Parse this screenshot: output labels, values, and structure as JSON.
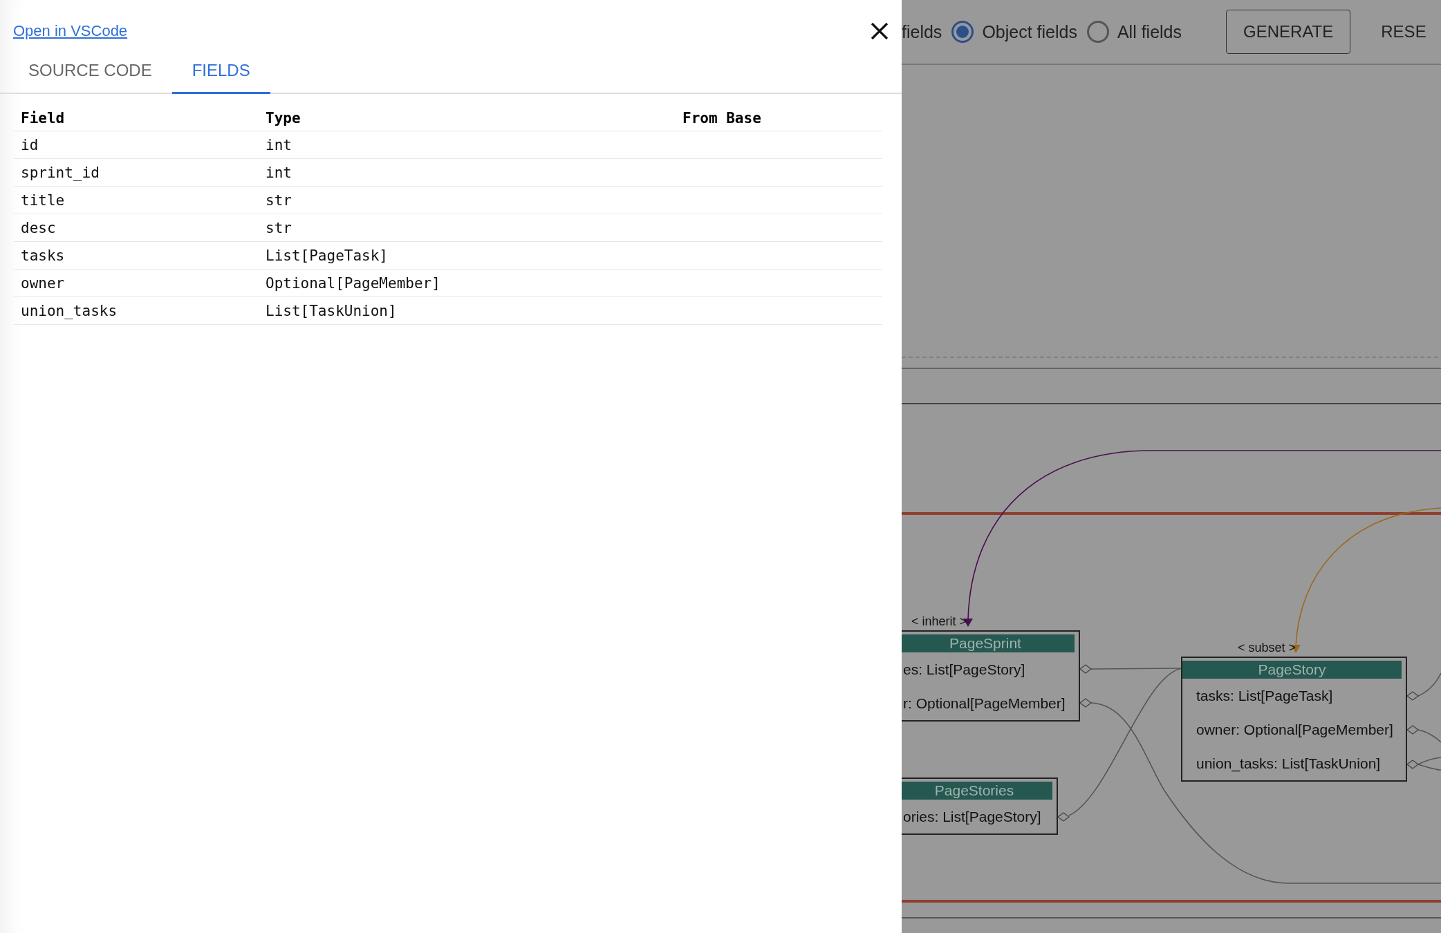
{
  "drawer": {
    "link": "Open in VSCode",
    "tabs": [
      {
        "label": "SOURCE CODE",
        "selected": false
      },
      {
        "label": "FIELDS",
        "selected": true
      }
    ],
    "table": {
      "columns": [
        "Field",
        "Type",
        "From Base"
      ],
      "rows": [
        {
          "field": "id",
          "type": "int"
        },
        {
          "field": "sprint_id",
          "type": "int"
        },
        {
          "field": "title",
          "type": "str"
        },
        {
          "field": "desc",
          "type": "str"
        },
        {
          "field": "tasks",
          "type": "List[PageTask]"
        },
        {
          "field": "owner",
          "type": "Optional[PageMember]"
        },
        {
          "field": "union_tasks",
          "type": "List[TaskUnion]"
        }
      ]
    }
  },
  "toolbar": {
    "cut_label": "fields",
    "radios": [
      {
        "label": "Object fields",
        "selected": true
      },
      {
        "label": "All fields",
        "selected": false
      }
    ],
    "buttons": [
      {
        "label": "GENERATE",
        "kind": "outlined"
      },
      {
        "label": "RESE",
        "kind": "text"
      }
    ]
  },
  "diagram": {
    "edge_labels": [
      "< inherit >",
      "< subset >"
    ],
    "nodes": [
      {
        "title": "PageSprint",
        "fields": [
          "es: List[PageStory]",
          "r: Optional[PageMember]"
        ]
      },
      {
        "title": "PageStory",
        "fields": [
          "tasks: List[PageTask]",
          "owner: Optional[PageMember]",
          "union_tasks: List[TaskUnion]"
        ]
      },
      {
        "title": "PageStories",
        "fields": [
          "ories: List[PageStory]"
        ]
      }
    ]
  }
}
